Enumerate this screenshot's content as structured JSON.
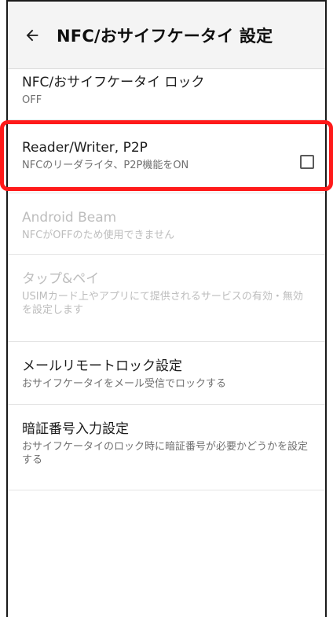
{
  "appbar": {
    "title": "NFC/おサイフケータイ 設定",
    "back_icon": "arrow-left-icon"
  },
  "settings": {
    "lock": {
      "title": "NFC/おサイフケータイ ロック",
      "summary": "OFF"
    },
    "reader_writer": {
      "title": "Reader/Writer, P2P",
      "summary": "NFCのリーダライタ、P2P機能をON",
      "checked": false
    },
    "android_beam": {
      "title": "Android Beam",
      "summary": "NFCがOFFのため使用できません",
      "enabled": false
    },
    "tap_pay": {
      "title": "タップ&ペイ",
      "summary": "USIMカード上やアプリにて提供されるサービスの有効・無効を設定します",
      "enabled": false
    },
    "mail_remote_lock": {
      "title": "メールリモートロック設定",
      "summary": "おサイフケータイをメール受信でロックする"
    },
    "pin_input": {
      "title": "暗証番号入力設定",
      "summary": "おサイフケータイのロック時に暗証番号が必要かどうかを設定する"
    }
  },
  "colors": {
    "highlight": "#ff1a1a",
    "appbar_bg": "#f4f4f4",
    "disabled_text": "#bdbdbd"
  }
}
